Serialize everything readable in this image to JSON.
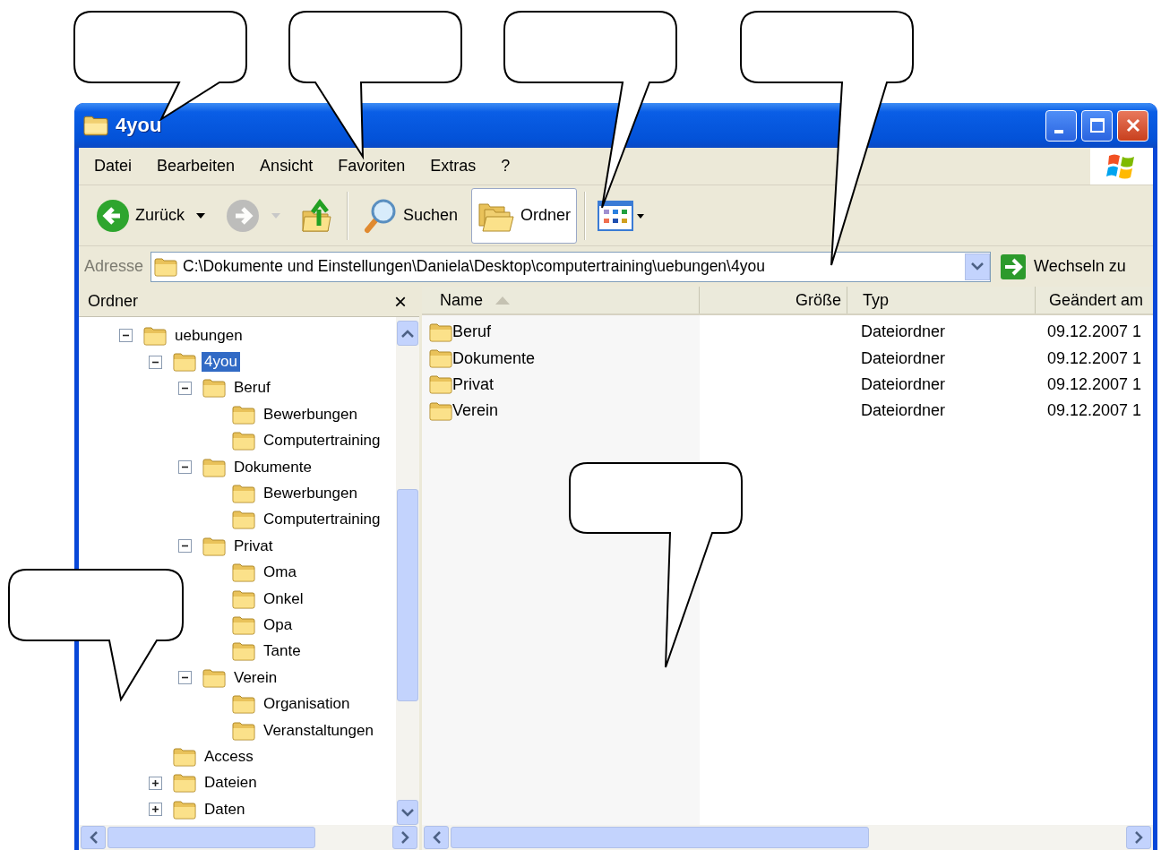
{
  "window": {
    "title": "4you"
  },
  "menu": [
    {
      "label": "Datei"
    },
    {
      "label": "Bearbeiten"
    },
    {
      "label": "Ansicht"
    },
    {
      "label": "Favoriten"
    },
    {
      "label": "Extras"
    },
    {
      "label": "?"
    }
  ],
  "toolbar": [
    {
      "kind": "back",
      "label": "Zurück",
      "disabled": false,
      "selected": false
    },
    {
      "kind": "forward",
      "disabled": true,
      "selected": false
    },
    {
      "kind": "up",
      "disabled": false,
      "selected": false
    },
    {
      "kind": "search",
      "label": "Suchen",
      "disabled": false,
      "selected": false
    },
    {
      "kind": "folders",
      "label": "Ordner",
      "disabled": false,
      "selected": true
    },
    {
      "kind": "views",
      "disabled": false,
      "selected": false
    }
  ],
  "address": {
    "label": "Adresse",
    "value": "C:\\Dokumente und Einstellungen\\Daniela\\Desktop\\computertraining\\uebungen\\4you",
    "go_label": "Wechseln zu"
  },
  "folder_pane": {
    "title": "Ordner",
    "close": "×",
    "tree": [
      {
        "label": "uebungen",
        "kind": "branch",
        "expanded": true,
        "selected": false,
        "children": [
          {
            "label": "4you",
            "kind": "branch",
            "expanded": true,
            "selected": true,
            "children": [
              {
                "label": "Beruf",
                "kind": "branch",
                "expanded": true,
                "selected": false,
                "children": [
                  {
                    "label": "Bewerbungen",
                    "kind": "leaf",
                    "selected": false
                  },
                  {
                    "label": "Computertraining",
                    "kind": "leaf",
                    "selected": false
                  }
                ]
              },
              {
                "label": "Dokumente",
                "kind": "branch",
                "expanded": true,
                "selected": false,
                "children": [
                  {
                    "label": "Bewerbungen",
                    "kind": "leaf",
                    "selected": false
                  },
                  {
                    "label": "Computertraining",
                    "kind": "leaf",
                    "selected": false
                  }
                ]
              },
              {
                "label": "Privat",
                "kind": "branch",
                "expanded": true,
                "selected": false,
                "children": [
                  {
                    "label": "Oma",
                    "kind": "leaf",
                    "selected": false
                  },
                  {
                    "label": "Onkel",
                    "kind": "leaf",
                    "selected": false
                  },
                  {
                    "label": "Opa",
                    "kind": "leaf",
                    "selected": false
                  },
                  {
                    "label": "Tante",
                    "kind": "leaf",
                    "selected": false
                  }
                ]
              },
              {
                "label": "Verein",
                "kind": "branch",
                "expanded": true,
                "selected": false,
                "children": [
                  {
                    "label": "Organisation",
                    "kind": "leaf",
                    "selected": false
                  },
                  {
                    "label": "Veranstaltungen",
                    "kind": "leaf",
                    "selected": false
                  }
                ]
              }
            ]
          },
          {
            "label": "Access",
            "kind": "leaf",
            "selected": false
          },
          {
            "label": "Dateien",
            "kind": "branch",
            "expanded": false,
            "selected": false
          },
          {
            "label": "Daten",
            "kind": "branch",
            "expanded": false,
            "selected": false
          }
        ]
      }
    ]
  },
  "file_list": {
    "columns": [
      {
        "label": "Name",
        "sorted": true
      },
      {
        "label": "Größe",
        "sorted": false
      },
      {
        "label": "Typ",
        "sorted": false
      },
      {
        "label": "Geändert am",
        "sorted": false
      }
    ],
    "rows": [
      {
        "name": "Beruf",
        "type": "Dateiordner",
        "modified": "09.12.2007 1"
      },
      {
        "name": "Dokumente",
        "type": "Dateiordner",
        "modified": "09.12.2007 1"
      },
      {
        "name": "Privat",
        "type": "Dateiordner",
        "modified": "09.12.2007 1"
      },
      {
        "name": "Verein",
        "type": "Dateiordner",
        "modified": "09.12.2007 1"
      }
    ]
  }
}
